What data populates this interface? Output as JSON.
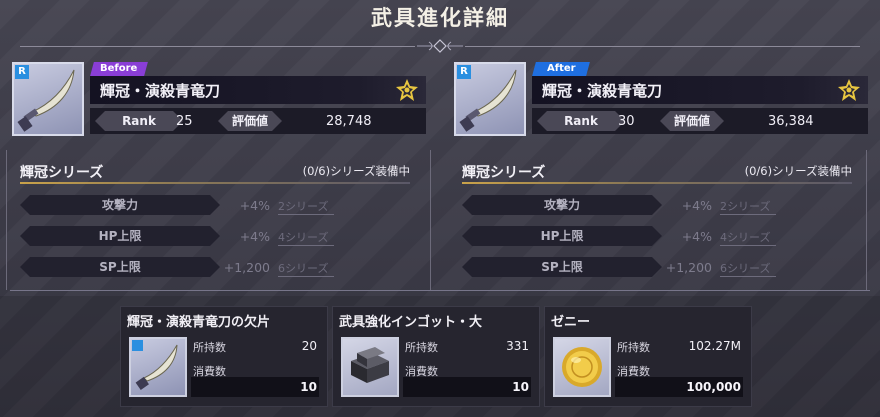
{
  "title": "武具進化詳細",
  "before": {
    "tag": "Before",
    "tag_color": "#8a3ed6",
    "weapon_name": "輝冠・演殺青竜刀",
    "rank_label": "Rank",
    "rank": "25",
    "score_label": "評価値",
    "score": "28,748",
    "rarity_badge": "R",
    "icon": "scimitar-icon"
  },
  "after": {
    "tag": "After",
    "tag_color": "#1f6fe0",
    "weapon_name": "輝冠・演殺青竜刀",
    "rank_label": "Rank",
    "rank": "30",
    "score_label": "評価値",
    "score": "36,384",
    "rarity_badge": "R",
    "icon": "scimitar-icon"
  },
  "series_left": {
    "title": "輝冠シリーズ",
    "count": "(0/6)シリーズ装備中",
    "bonuses": [
      {
        "stat": "攻撃力",
        "value": "+4%",
        "requirement": "2シリーズ"
      },
      {
        "stat": "HP上限",
        "value": "+4%",
        "requirement": "4シリーズ"
      },
      {
        "stat": "SP上限",
        "value": "+1,200",
        "requirement": "6シリーズ"
      }
    ]
  },
  "series_right": {
    "title": "輝冠シリーズ",
    "count": "(0/6)シリーズ装備中",
    "bonuses": [
      {
        "stat": "攻撃力",
        "value": "+4%",
        "requirement": "2シリーズ"
      },
      {
        "stat": "HP上限",
        "value": "+4%",
        "requirement": "4シリーズ"
      },
      {
        "stat": "SP上限",
        "value": "+1,200",
        "requirement": "6シリーズ"
      }
    ]
  },
  "materials": [
    {
      "name": "輝冠・演殺青竜刀の欠片",
      "owned_label": "所持数",
      "owned": "20",
      "cost_label": "消費数",
      "cost": "10",
      "icon": "scimitar-icon"
    },
    {
      "name": "武具強化インゴット・大",
      "owned_label": "所持数",
      "owned": "331",
      "cost_label": "消費数",
      "cost": "10",
      "icon": "ingot-icon"
    },
    {
      "name": "ゼニー",
      "owned_label": "所持数",
      "owned": "102.27M",
      "cost_label": "消費数",
      "cost": "100,000",
      "icon": "gold-coin-icon"
    }
  ],
  "colors": {
    "accent_gold": "#e8c640",
    "series_line": "#c9a24a"
  }
}
